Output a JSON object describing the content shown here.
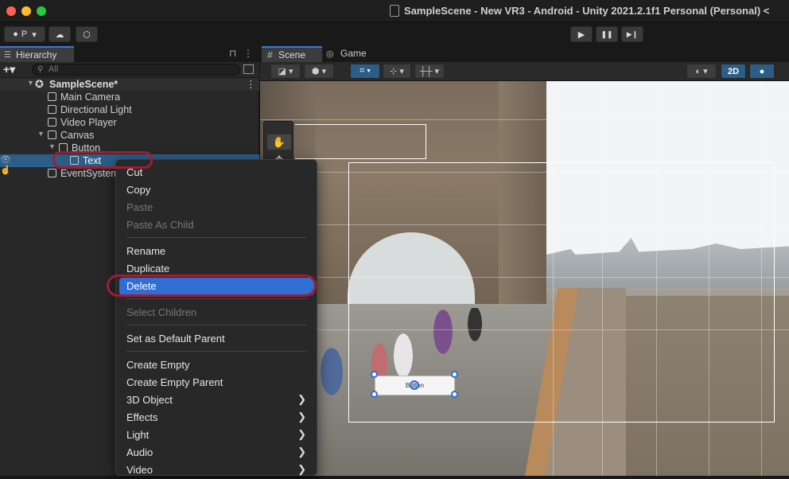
{
  "window": {
    "title": "SampleScene - New VR3 - Android - Unity 2021.2.1f1 Personal (Personal) <"
  },
  "toolbar": {
    "account_label": "P",
    "account_arrow": "▾",
    "cloud_icon": "☁",
    "collab_icon": "⬡",
    "play_icon": "▶",
    "pause_icon": "❚❚",
    "step_icon": "▶❙"
  },
  "hierarchy": {
    "tab_label": "Hierarchy",
    "tab_icon": "☰",
    "lock_icon": "🔒",
    "menu_icon": "⋮",
    "add_label": "+▾",
    "search_placeholder": "All",
    "search_icon": "⚲",
    "scene_name": "SampleScene*",
    "scene_icon": "✪",
    "scene_menu_icon": "⋮",
    "items": [
      {
        "label": "Main Camera"
      },
      {
        "label": "Directional Light"
      },
      {
        "label": "Video Player"
      },
      {
        "label": "Canvas"
      },
      {
        "label": "Button"
      },
      {
        "label": "Text"
      },
      {
        "label": "EventSystem"
      }
    ],
    "expand_arrow": "▼",
    "visibility_icons": "👁 ☝"
  },
  "scene": {
    "tab_scene": "Scene",
    "tab_scene_icon": "#",
    "tab_game": "Game",
    "tab_game_icon": "👾",
    "tools": {
      "shading": "◪ ▾",
      "draw": "⬢ ▾",
      "grid": "⌗ ▾",
      "snap": "⊹ ▾",
      "increment": "┼┼ ▾",
      "gizmo": "◐ ▾",
      "mode_2d": "2D",
      "light": "💡"
    },
    "palette": {
      "hand": "✋",
      "move": "✥",
      "rotate": "⟳",
      "scale": "⤡"
    },
    "button_text": "Button"
  },
  "context_menu": {
    "items": [
      {
        "label": "Cut",
        "disabled": false
      },
      {
        "label": "Copy",
        "disabled": false
      },
      {
        "label": "Paste",
        "disabled": true
      },
      {
        "label": "Paste As Child",
        "disabled": true
      },
      {
        "label": "Rename",
        "disabled": false
      },
      {
        "label": "Duplicate",
        "disabled": false
      },
      {
        "label": "Delete",
        "disabled": false,
        "active": true
      },
      {
        "label": "Select Children",
        "disabled": true
      },
      {
        "label": "Set as Default Parent",
        "disabled": false
      },
      {
        "label": "Create Empty",
        "disabled": false
      },
      {
        "label": "Create Empty Parent",
        "disabled": false
      },
      {
        "label": "3D Object",
        "submenu": true
      },
      {
        "label": "Effects",
        "submenu": true
      },
      {
        "label": "Light",
        "submenu": true
      },
      {
        "label": "Audio",
        "submenu": true
      },
      {
        "label": "Video",
        "submenu": true
      }
    ],
    "submenu_arrow": "❯"
  },
  "colors": {
    "accent": "#2f6ed3",
    "highlight_annotation": "#a01d30",
    "selected_row": "#2c5d87"
  }
}
